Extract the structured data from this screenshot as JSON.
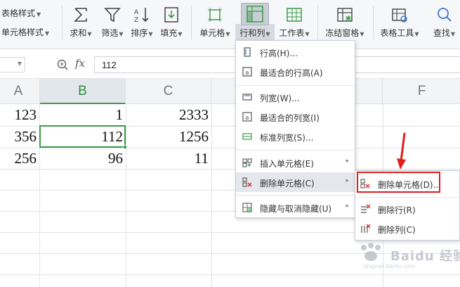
{
  "ribbon": {
    "left_row1": "表格样式",
    "left_row2": "单元格样式",
    "buttons": [
      {
        "label": "求和",
        "icon": "sum-icon"
      },
      {
        "label": "筛选",
        "icon": "filter-icon"
      },
      {
        "label": "排序",
        "icon": "sort-icon"
      },
      {
        "label": "填充",
        "icon": "fill-icon"
      },
      {
        "label": "单元格",
        "icon": "cell-icon"
      },
      {
        "label": "行和列",
        "icon": "rows-columns-icon"
      },
      {
        "label": "工作表",
        "icon": "worksheet-icon"
      },
      {
        "label": "冻结窗格",
        "icon": "freeze-panes-icon"
      },
      {
        "label": "表格工具",
        "icon": "table-tools-icon"
      },
      {
        "label": "查找",
        "icon": "search-icon"
      }
    ]
  },
  "formula_bar": {
    "fx_label": "fx",
    "value": "112"
  },
  "sheet": {
    "columns": [
      "A",
      "B",
      "C",
      "F"
    ],
    "rows": [
      [
        "123",
        "1",
        "2333"
      ],
      [
        "356",
        "112",
        "1256"
      ],
      [
        "256",
        "96",
        "11"
      ]
    ],
    "active_cell_value": "112"
  },
  "menu": {
    "items": [
      {
        "label": "行高(H)...",
        "icon": "row-height-icon"
      },
      {
        "label": "最适合的行高(A)",
        "icon": "autofit-row-icon"
      },
      {
        "label": "列宽(W)...",
        "icon": "column-width-icon"
      },
      {
        "label": "最适合的列宽(I)",
        "icon": "autofit-column-icon"
      },
      {
        "label": "标准列宽(S)...",
        "icon": "standard-width-icon"
      },
      {
        "label": "插入单元格(E)",
        "icon": "insert-cells-icon"
      },
      {
        "label": "删除单元格(C)",
        "icon": "delete-cells-icon"
      },
      {
        "label": "隐藏与取消隐藏(U)",
        "icon": "hide-unhide-icon"
      }
    ]
  },
  "submenu": {
    "items": [
      {
        "label": "删除单元格(D)...",
        "icon": "delete-cells-icon"
      },
      {
        "label": "删除行(R)",
        "icon": "delete-row-icon"
      },
      {
        "label": "删除列(C)",
        "icon": "delete-column-icon"
      }
    ]
  },
  "watermark": {
    "text": "Baidu 经验",
    "sub": "jingyan.baidu.com"
  },
  "colors": {
    "accent_green": "#3c9b4a",
    "highlight_red": "#e31b1b",
    "ribbon_bg": "#f6f7f9"
  }
}
